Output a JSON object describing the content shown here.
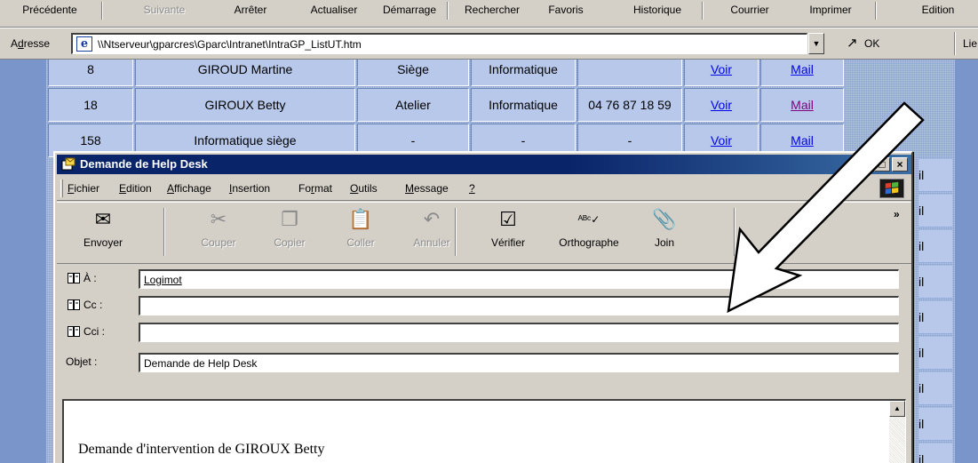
{
  "browser": {
    "toolbar": [
      {
        "label": "Précédente",
        "enabled": true
      },
      {
        "label": "Suivante",
        "enabled": false
      },
      {
        "label": "Arrêter",
        "enabled": true
      },
      {
        "label": "Actualiser",
        "enabled": true
      },
      {
        "label": "Démarrage",
        "enabled": true
      },
      {
        "label": "Rechercher",
        "enabled": true
      },
      {
        "label": "Favoris",
        "enabled": true
      },
      {
        "label": "Historique",
        "enabled": true
      },
      {
        "label": "Courrier",
        "enabled": true
      },
      {
        "label": "Imprimer",
        "enabled": true
      },
      {
        "label": "Edition",
        "enabled": true
      }
    ],
    "address": {
      "label_prefix": "A",
      "label_mnemonic": "d",
      "label_rest": "resse",
      "value": "\\\\Ntserveur\\gparcres\\Gparc\\Intranet\\IntraGP_ListUT.htm",
      "go_icon": "↗",
      "go_label": "OK",
      "links_label": "Lie"
    }
  },
  "web_page": {
    "rows": [
      {
        "id": "8",
        "name": "GIROUD Martine",
        "site": "Siège",
        "service": "Informatique",
        "phone": "",
        "view": "Voir",
        "mail": "Mail",
        "mail_visited": false
      },
      {
        "id": "18",
        "name": "GIROUX Betty",
        "site": "Atelier",
        "service": "Informatique",
        "phone": "04 76 87 18 59",
        "view": "Voir",
        "mail": "Mail",
        "mail_visited": true
      },
      {
        "id": "158",
        "name": "Informatique siège",
        "site": "-",
        "service": "-",
        "phone": "-",
        "view": "Voir",
        "mail": "Mail",
        "mail_visited": false
      }
    ],
    "mail_stub": "il",
    "colors": {
      "page_bg": "#8aa3d3",
      "cell_bg": "#b7c8ea",
      "link": "#0000ee",
      "visited": "#800080"
    }
  },
  "compose": {
    "title": "Demande de Help Desk",
    "title_buttons": [
      "□",
      "×"
    ],
    "menu": [
      {
        "mnemonic": "F",
        "rest": "ichier"
      },
      {
        "mnemonic": "E",
        "rest": "dition"
      },
      {
        "mnemonic": "A",
        "rest": "ffichage"
      },
      {
        "mnemonic": "I",
        "rest": "nsertion"
      },
      {
        "pre": "Fo",
        "mnemonic": "r",
        "rest": "mat"
      },
      {
        "mnemonic": "O",
        "rest": "utils"
      },
      {
        "mnemonic": "M",
        "rest": "essage"
      },
      {
        "mnemonic": "?",
        "rest": ""
      }
    ],
    "buttons": [
      {
        "label": "Envoyer",
        "icon": "send-icon",
        "glyph": "✉",
        "enabled": true
      },
      {
        "label": "Couper",
        "icon": "scissors-icon",
        "glyph": "✂",
        "enabled": false
      },
      {
        "label": "Copier",
        "icon": "copy-icon",
        "glyph": "❐",
        "enabled": false
      },
      {
        "label": "Coller",
        "icon": "paste-icon",
        "glyph": "📋",
        "enabled": false
      },
      {
        "label": "Annuler",
        "icon": "undo-icon",
        "glyph": "↶",
        "enabled": false
      },
      {
        "label": "Vérifier",
        "icon": "check-names-icon",
        "glyph": "☑",
        "enabled": true
      },
      {
        "label": "Orthographe",
        "icon": "spelling-icon",
        "glyph": "ᴬᴮᶜ✓",
        "enabled": true
      },
      {
        "label": "Join",
        "icon": "attach-icon",
        "glyph": "📎",
        "enabled": true
      }
    ],
    "chevron": "»",
    "headers": {
      "to_label": "À :",
      "to_value": "Logimot",
      "cc_label": "Cc :",
      "cc_value": "",
      "bcc_label": "Cci :",
      "bcc_value": "",
      "subject_label": "Objet :",
      "subject_value": "Demande de Help Desk"
    },
    "body_text": "Demande d'intervention de GIROUX Betty",
    "scroll_up_glyph": "▲"
  },
  "annotation": {
    "icon": "arrow-annotation-icon",
    "color": "#000000"
  }
}
